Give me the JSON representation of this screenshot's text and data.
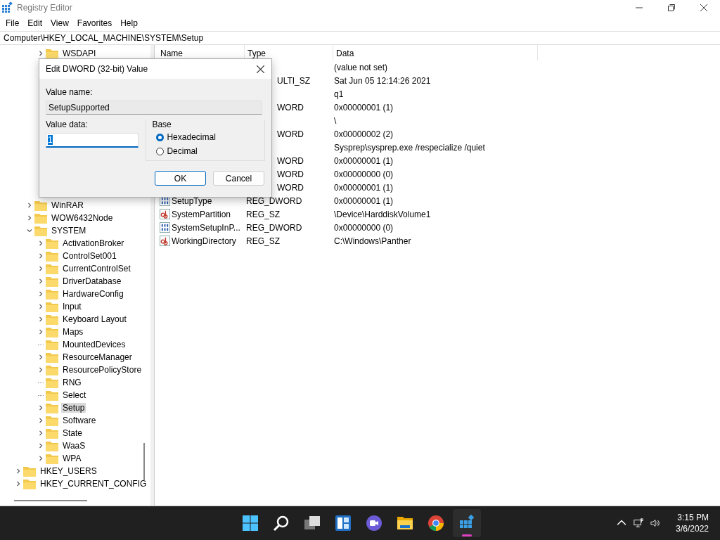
{
  "window": {
    "title": "Registry Editor"
  },
  "menu": [
    "File",
    "Edit",
    "View",
    "Favorites",
    "Help"
  ],
  "address": "Computer\\HKEY_LOCAL_MACHINE\\SYSTEM\\Setup",
  "tree": [
    {
      "children": [
        {
          "children": [
            {
              "label": "WSDAPI",
              "has_children": true,
              "expanded": false,
              "selected": false
            }
          ]
        },
        {
          "label": "WinRAR",
          "has_children": true,
          "expanded": false,
          "selected": false
        },
        {
          "label": "WOW6432Node",
          "has_children": true,
          "expanded": false,
          "selected": false
        }
      ]
    },
    {
      "children": [
        {
          "label": "SYSTEM",
          "has_children": true,
          "expanded": true,
          "selected": false,
          "children": [
            {
              "label": "ActivationBroker",
              "has_children": true,
              "expanded": false,
              "selected": false
            },
            {
              "label": "ControlSet001",
              "has_children": true,
              "expanded": false,
              "selected": false
            },
            {
              "label": "CurrentControlSet",
              "has_children": true,
              "expanded": false,
              "selected": false
            },
            {
              "label": "DriverDatabase",
              "has_children": true,
              "expanded": false,
              "selected": false
            },
            {
              "label": "HardwareConfig",
              "has_children": true,
              "expanded": false,
              "selected": false
            },
            {
              "label": "Input",
              "has_children": true,
              "expanded": false,
              "selected": false
            },
            {
              "label": "Keyboard Layout",
              "has_children": true,
              "expanded": false,
              "selected": false
            },
            {
              "label": "Maps",
              "has_children": true,
              "expanded": false,
              "selected": false
            },
            {
              "label": "MountedDevices",
              "has_children": false,
              "selected": false
            },
            {
              "label": "ResourceManager",
              "has_children": true,
              "expanded": false,
              "selected": false
            },
            {
              "label": "ResourcePolicyStore",
              "has_children": true,
              "expanded": false,
              "selected": false
            },
            {
              "label": "RNG",
              "has_children": false,
              "selected": false
            },
            {
              "label": "Select",
              "has_children": false,
              "selected": false
            },
            {
              "label": "Setup",
              "has_children": true,
              "expanded": false,
              "selected": true
            },
            {
              "label": "Software",
              "has_children": true,
              "expanded": false,
              "selected": false
            },
            {
              "label": "State",
              "has_children": true,
              "expanded": false,
              "selected": false
            },
            {
              "label": "WaaS",
              "has_children": true,
              "expanded": false,
              "selected": false
            },
            {
              "label": "WPA",
              "has_children": true,
              "expanded": false,
              "selected": false
            }
          ]
        }
      ]
    },
    {
      "label": "HKEY_USERS",
      "has_children": true,
      "expanded": false,
      "selected": false
    },
    {
      "label": "HKEY_CURRENT_CONFIG",
      "has_children": true,
      "expanded": false,
      "selected": false
    }
  ],
  "table": {
    "columns": [
      "Name",
      "Type",
      "Data"
    ],
    "rows": [
      {
        "data": "(value not set)"
      },
      {
        "type": "ULTI_SZ",
        "data": "Sat Jun 05 12:14:26 2021"
      },
      {
        "data": "q1"
      },
      {
        "type": "WORD",
        "data": "0x00000001 (1)"
      },
      {
        "data": "\\"
      },
      {
        "type": "WORD",
        "data": "0x00000002 (2)"
      },
      {
        "data": "Sysprep\\sysprep.exe /respecialize /quiet"
      },
      {
        "type": "WORD",
        "data": "0x00000001 (1)"
      },
      {
        "type": "WORD",
        "data": "0x00000000 (0)"
      },
      {
        "type": "WORD",
        "data": "0x00000001 (1)"
      },
      {
        "kind": "dword",
        "name": "SetupType",
        "type": "REG_DWORD",
        "data": "0x00000001 (1)"
      },
      {
        "kind": "sz",
        "name": "SystemPartition",
        "type": "REG_SZ",
        "data": "\\Device\\HarddiskVolume1"
      },
      {
        "kind": "dword",
        "name": "SystemSetupInP...",
        "type": "REG_DWORD",
        "data": "0x00000000 (0)"
      },
      {
        "kind": "sz",
        "name": "WorkingDirectory",
        "type": "REG_SZ",
        "data": "C:\\Windows\\Panther"
      }
    ]
  },
  "dialog": {
    "title": "Edit DWORD (32-bit) Value",
    "value_name_label": "Value name:",
    "value_name": "SetupSupported",
    "value_data_label": "Value data:",
    "value_data": "1",
    "base_label": "Base",
    "bases": [
      {
        "label": "Hexadecimal",
        "selected": true
      },
      {
        "label": "Decimal",
        "selected": false
      }
    ],
    "buttons": [
      {
        "label": "OK",
        "default": true
      },
      {
        "label": "Cancel",
        "default": false
      }
    ]
  },
  "taskbar": {
    "apps": [
      {
        "kind": "start",
        "active": false
      },
      {
        "kind": "search",
        "active": false
      },
      {
        "kind": "taskview",
        "active": false
      },
      {
        "kind": "widgets",
        "active": false
      },
      {
        "kind": "chat",
        "active": false
      },
      {
        "kind": "explorer",
        "active": false
      },
      {
        "kind": "browser",
        "active": false
      },
      {
        "kind": "regedit",
        "active": true
      }
    ],
    "time": "3:15 PM",
    "date": "3/6/2022"
  }
}
